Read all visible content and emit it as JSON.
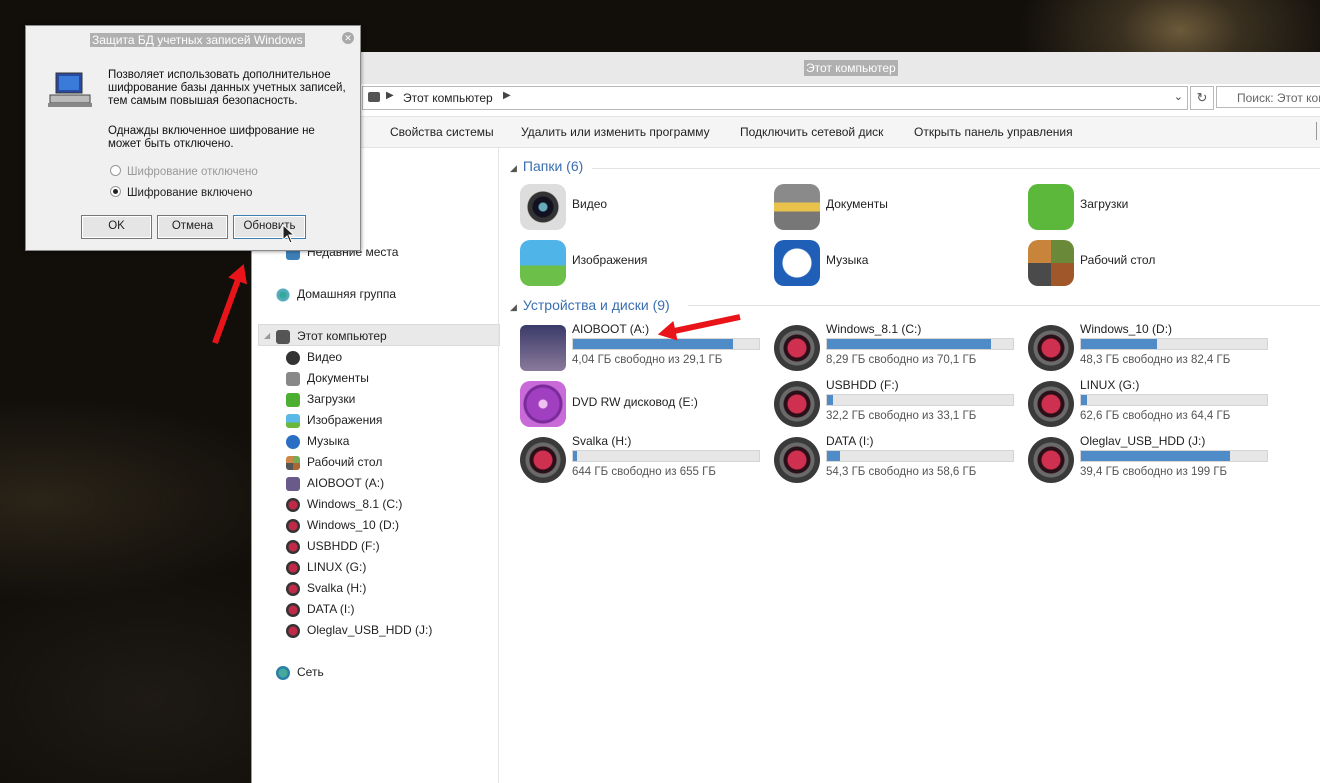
{
  "explorer": {
    "title": "Этот компьютер",
    "address_path": "Этот компьютер",
    "search_placeholder": "Поиск: Этот компьютер",
    "ribbon": [
      "Свойства системы",
      "Удалить или изменить программу",
      "Подключить сетевой диск",
      "Открыть панель управления"
    ],
    "nav": {
      "recent": "Недавние места",
      "homegroup": "Домашняя группа",
      "this_pc": "Этот компьютер",
      "children": [
        "Видео",
        "Документы",
        "Загрузки",
        "Изображения",
        "Музыка",
        "Рабочий стол",
        "AIOBOOT (A:)",
        "Windows_8.1 (C:)",
        "Windows_10 (D:)",
        "USBHDD (F:)",
        "LINUX (G:)",
        "Svalka (H:)",
        "DATA (I:)",
        "Oleglav_USB_HDD (J:)"
      ],
      "network": "Сеть"
    },
    "folders_header": "Папки (6)",
    "folders": [
      "Видео",
      "Документы",
      "Загрузки",
      "Изображения",
      "Музыка",
      "Рабочий стол"
    ],
    "devices_header": "Устройства и диски (9)",
    "drives": [
      {
        "name": "AIOBOOT (A:)",
        "free": "4,04 ГБ свободно из 29,1 ГБ",
        "used": 0.86
      },
      {
        "name": "Windows_8.1 (C:)",
        "free": "8,29 ГБ свободно из 70,1 ГБ",
        "used": 0.88
      },
      {
        "name": "Windows_10 (D:)",
        "free": "48,3 ГБ свободно из 82,4 ГБ",
        "used": 0.41
      },
      {
        "name": "DVD RW дисковод (E:)",
        "free": "",
        "used": null
      },
      {
        "name": "USBHDD (F:)",
        "free": "32,2 ГБ свободно из 33,1 ГБ",
        "used": 0.03
      },
      {
        "name": "LINUX (G:)",
        "free": "62,6 ГБ свободно из 64,4 ГБ",
        "used": 0.03
      },
      {
        "name": "Svalka (H:)",
        "free": "644 ГБ свободно из 655 ГБ",
        "used": 0.02
      },
      {
        "name": "DATA (I:)",
        "free": "54,3 ГБ свободно из 58,6 ГБ",
        "used": 0.07
      },
      {
        "name": "Oleglav_USB_HDD (J:)",
        "free": "39,4 ГБ свободно из 199 ГБ",
        "used": 0.8
      }
    ]
  },
  "dialog": {
    "title": "Защита БД учетных записей Windows",
    "text1": "Позволяет использовать дополнительное шифрование базы данных учетных записей, тем самым повышая безопасность.",
    "text2": "Однажды включенное шифрование не может быть отключено.",
    "radio_off": "Шифрование отключено",
    "radio_on": "Шифрование включено",
    "ok": "OK",
    "cancel": "Отмена",
    "update": "Обновить"
  },
  "colors": {
    "accent": "#3a6fb0",
    "bar": "#4f8cc7",
    "arrow": "#e8141a"
  }
}
